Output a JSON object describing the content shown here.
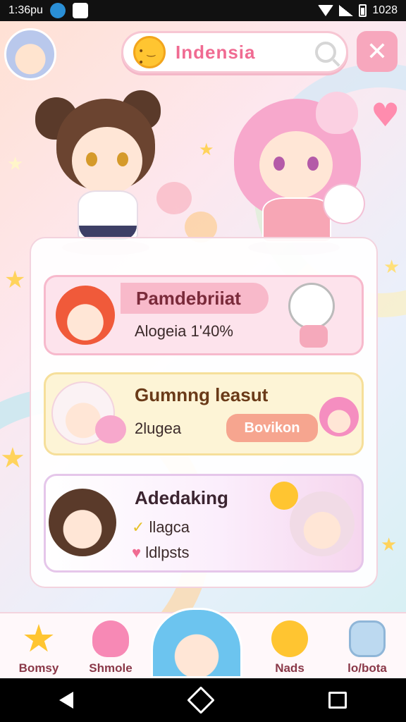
{
  "status_bar": {
    "time": "1:36pu",
    "battery_text": "1028"
  },
  "header": {
    "search_text": "Indensia",
    "icons": [
      "app-avatar",
      "sun-mascot-icon",
      "search-icon",
      "close-icon"
    ]
  },
  "cards": [
    {
      "title": "Pamdebriiat",
      "subtitle": "Alogeia 1'40%",
      "accent": "#f7b9cc"
    },
    {
      "title": "Gumnng leasut",
      "subtitle": "2lugea",
      "button": "Bovikon",
      "accent": "#f6df9a"
    },
    {
      "title": "Adedaking",
      "lines": [
        "llagca",
        "ldlpsts"
      ],
      "accent": "#e5c6ea"
    }
  ],
  "bottom_nav": [
    {
      "label": "Bomsy",
      "icon": "star-icon"
    },
    {
      "label": "Shmole",
      "icon": "heart-icon"
    },
    {
      "label": "",
      "icon": "character-avatar"
    },
    {
      "label": "Nads",
      "icon": "mascot-icon"
    },
    {
      "label": "lo/bota",
      "icon": "robot-icon"
    }
  ],
  "colors": {
    "accent_pink": "#f06b92",
    "panel_border": "#f3d3de",
    "nav_text": "#8a3848"
  }
}
